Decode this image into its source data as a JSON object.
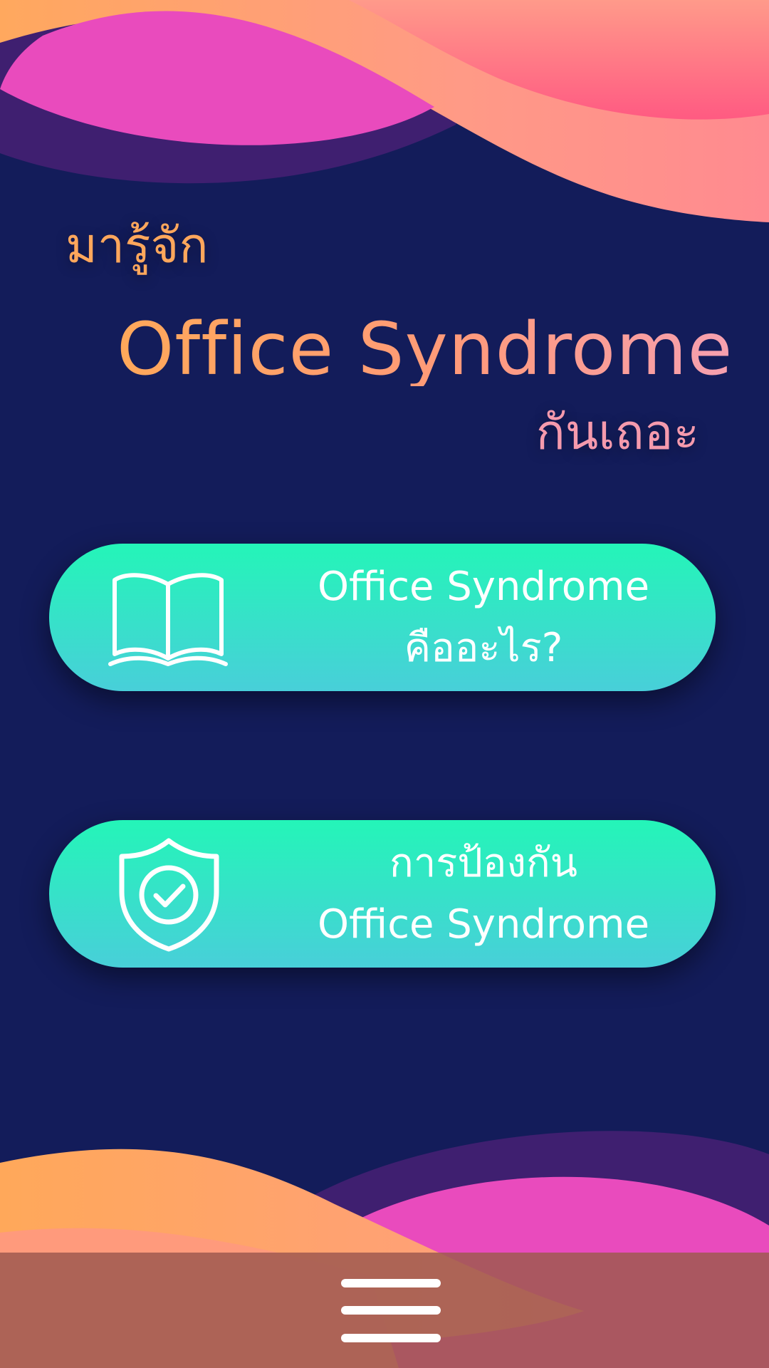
{
  "header": {
    "line1": "มารู้จัก",
    "line2": "Office Syndrome",
    "line3": "กันเถอะ"
  },
  "buttons": [
    {
      "icon": "open-book-icon",
      "line1": "Office Syndrome",
      "line2": "คืออะไร?"
    },
    {
      "icon": "shield-check-icon",
      "line1": "การป้องกัน",
      "line2": "Office Syndrome"
    }
  ],
  "bottom_nav": {
    "icon": "hamburger-menu-icon"
  },
  "colors": {
    "background": "#131c5a",
    "button_top": "#24f5b8",
    "button_bottom": "#48cfd9",
    "accent_orange": "#ffa75c",
    "accent_pink": "#f59aad",
    "wave_magenta": "#e94bbd",
    "wave_purple": "#3f1f70"
  }
}
